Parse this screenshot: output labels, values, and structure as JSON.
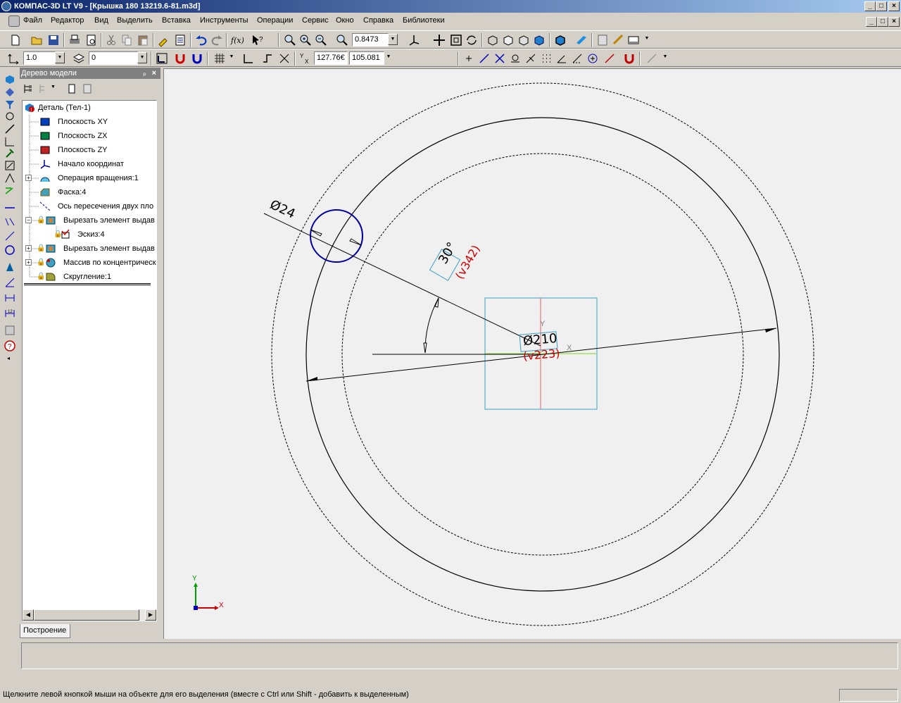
{
  "window": {
    "title": "КОМПАС-3D LT V9 - [Крышка 180 13219.6-81.m3d]"
  },
  "menu": [
    "Файл",
    "Редактор",
    "Вид",
    "Выделить",
    "Вставка",
    "Инструменты",
    "Операции",
    "Сервис",
    "Окно",
    "Справка",
    "Библиотеки"
  ],
  "toolbar": {
    "zoom_value": "0.8473",
    "line_scale": "1.0",
    "layer_value": "0",
    "coord_x": "127.76€",
    "coord_y": "105.081"
  },
  "panel": {
    "title": "Дерево модели",
    "tab_label": "Построение"
  },
  "tree": {
    "root": "Деталь (Тел-1)",
    "items": [
      "Плоскость XY",
      "Плоскость ZX",
      "Плоскость ZY",
      "Начало координат",
      "Операция вращения:1",
      "Фаска:4",
      "Ось пересечения двух пло",
      "Вырезать элемент выдав",
      "Эскиз:4",
      "Вырезать элемент выдав",
      "Массив по концентрическ",
      "Скругление:1"
    ]
  },
  "drawing": {
    "dim_small_circle": "Ø24",
    "dim_angle": "30°",
    "dim_angle_var": "(v342)",
    "dim_big": "Ø210",
    "dim_big_var": "(v223)",
    "axis_y": "Y",
    "axis_x": "X",
    "origin_y": "Y",
    "origin_x": "X"
  },
  "status": {
    "hint": "Щелкните левой кнопкой мыши на объекте для его выделения (вместе с Ctrl или Shift - добавить к выделенным)"
  },
  "colors": {
    "title_start": "#0a246a",
    "title_end": "#a6caf0",
    "sketch_circle": "#0000a0",
    "dimension_var": "#d00000",
    "cyan_frame": "#3aa0c0"
  }
}
